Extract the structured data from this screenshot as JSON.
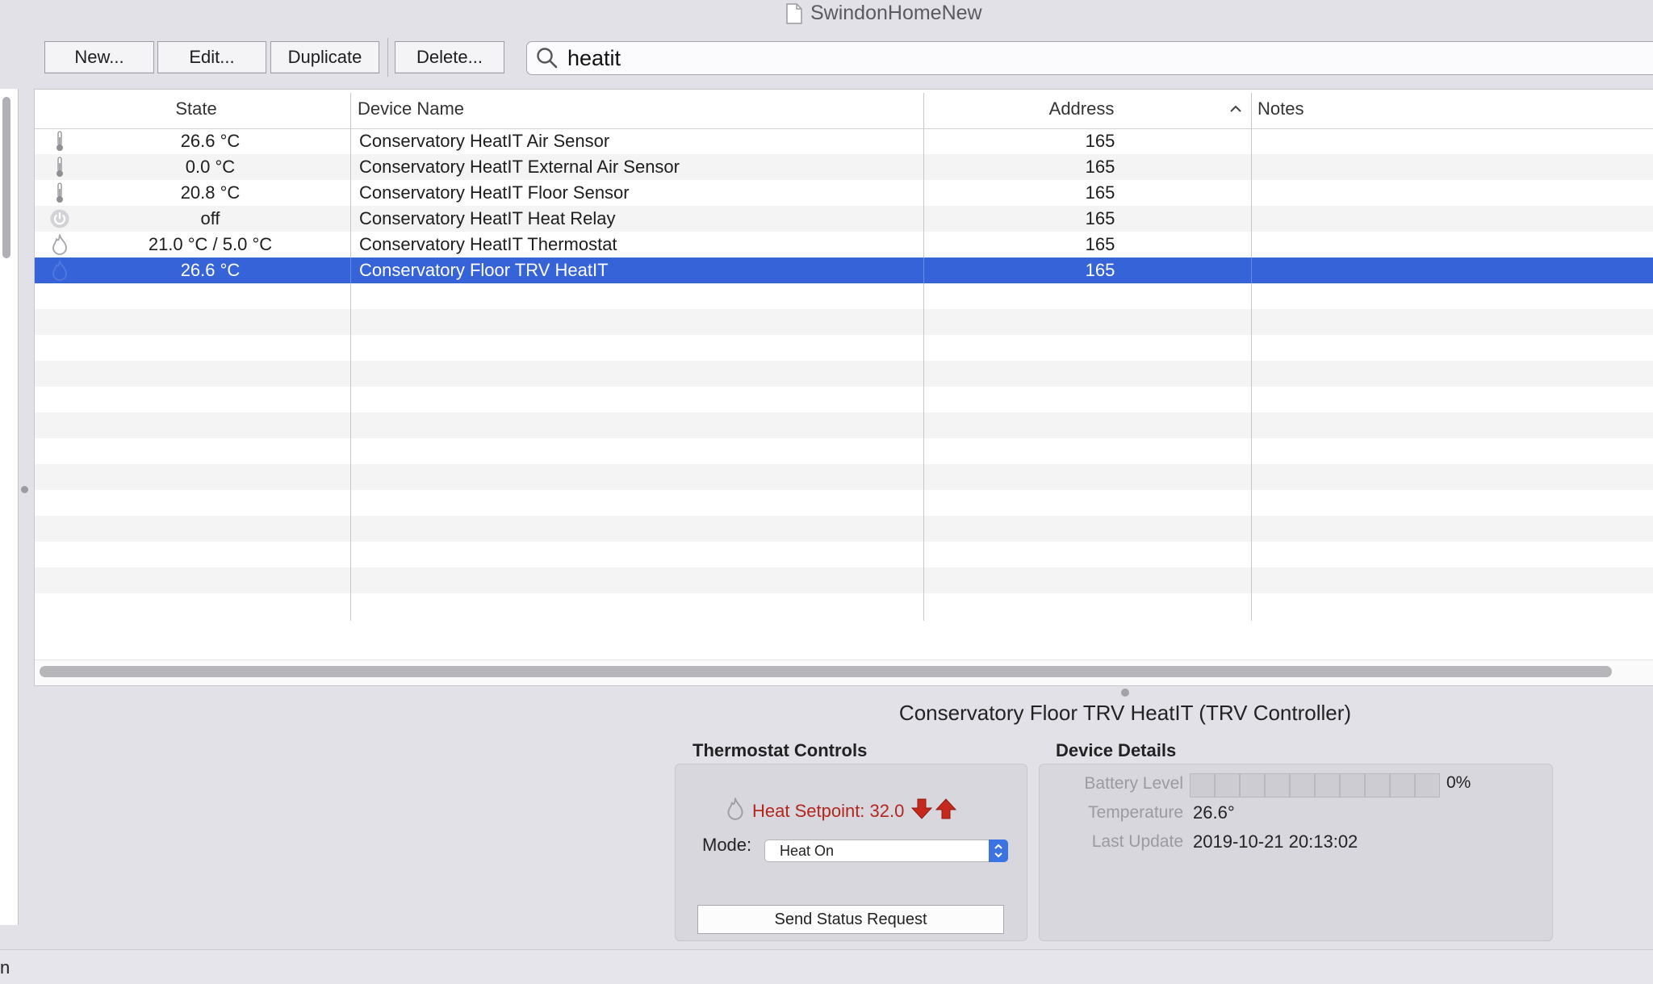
{
  "window": {
    "title": "SwindonHomeNew"
  },
  "toolbar": {
    "new_label": "New...",
    "edit_label": "Edit...",
    "duplicate_label": "Duplicate",
    "delete_label": "Delete..."
  },
  "search": {
    "value": "heatit",
    "icon": "search-icon"
  },
  "table": {
    "headers": {
      "state": "State",
      "device_name": "Device Name",
      "address": "Address",
      "notes": "Notes"
    },
    "sort": {
      "column": "Address",
      "direction": "ascending"
    },
    "rows": [
      {
        "icon": "thermometer-icon",
        "state": "26.6 °C",
        "name": "Conservatory HeatIT Air Sensor",
        "address": "165",
        "notes": ""
      },
      {
        "icon": "thermometer-icon",
        "state": "0.0 °C",
        "name": "Conservatory HeatIT External Air Sensor",
        "address": "165",
        "notes": ""
      },
      {
        "icon": "thermometer-icon",
        "state": "20.8 °C",
        "name": "Conservatory HeatIT Floor Sensor",
        "address": "165",
        "notes": ""
      },
      {
        "icon": "power-icon",
        "state": "off",
        "name": "Conservatory HeatIT Heat Relay",
        "address": "165",
        "notes": ""
      },
      {
        "icon": "flame-icon",
        "state": "21.0 °C / 5.0 °C",
        "name": "Conservatory HeatIT Thermostat",
        "address": "165",
        "notes": ""
      },
      {
        "icon": "flame-icon",
        "state": "26.6 °C",
        "name": "Conservatory Floor TRV HeatIT",
        "address": "165",
        "notes": "",
        "selected": true
      }
    ]
  },
  "detail": {
    "title": "Conservatory Floor TRV HeatIT (TRV Controller)",
    "thermostat": {
      "heading": "Thermostat Controls",
      "setpoint_text": "Heat Setpoint: 32.0",
      "mode_label": "Mode:",
      "mode_value": "Heat On",
      "send_button": "Send Status Request"
    },
    "device": {
      "heading": "Device Details",
      "battery_label": "Battery Level",
      "battery_value": "0%",
      "battery_fraction": 0,
      "temperature_label": "Temperature",
      "temperature_value": "26.6°",
      "last_update_label": "Last Update",
      "last_update_value": "2019-10-21 20:13:02"
    }
  },
  "statusbar": {
    "text": "n"
  },
  "colors": {
    "selection": "#3663d8",
    "setpoint_red": "#b3261e",
    "accent_blue": "#3b74e2"
  }
}
